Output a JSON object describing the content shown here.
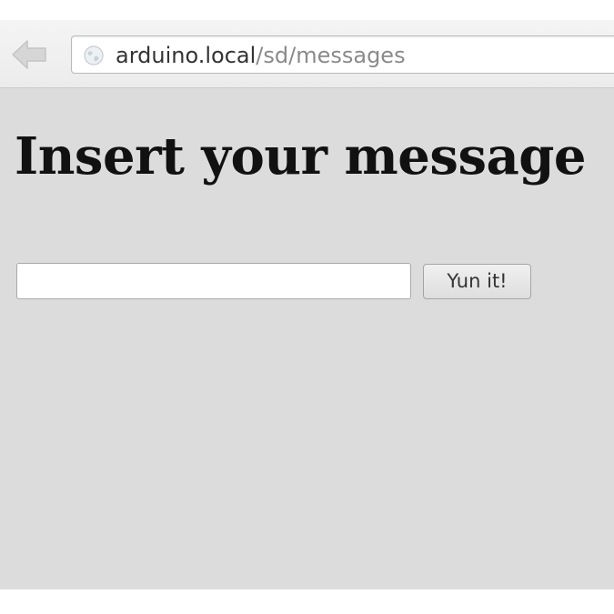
{
  "browser": {
    "url_host": "arduino.local",
    "url_path": "/sd/messages",
    "back_icon": "arrow-left-icon",
    "site_icon": "globe-icon"
  },
  "page": {
    "title": "Insert your message",
    "message_input": {
      "value": "",
      "placeholder": ""
    },
    "submit_label": "Yun it!"
  },
  "colors": {
    "page_background": "#dcdcdc",
    "toolbar_background": "#f0f0f0",
    "url_host": "#333333",
    "url_path": "#8a8a8a"
  }
}
